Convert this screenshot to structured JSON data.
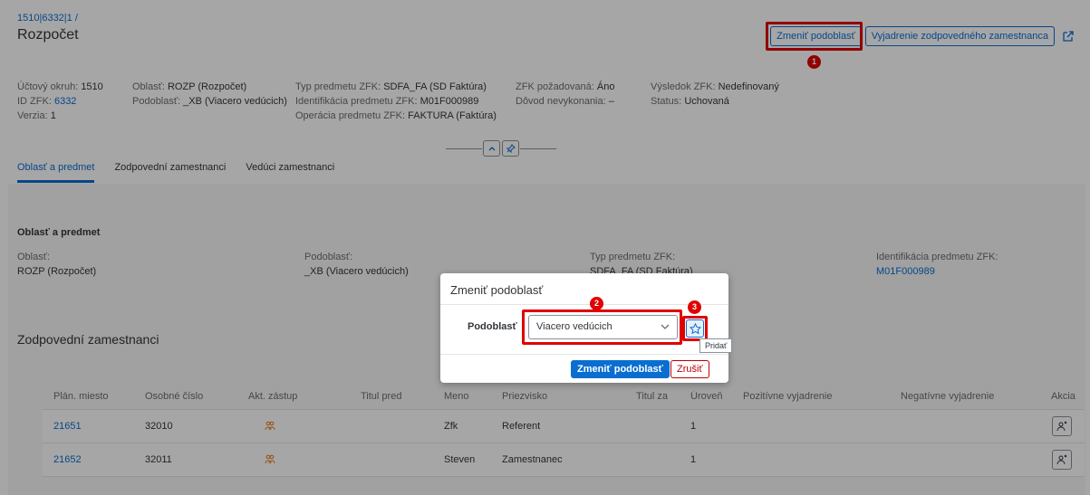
{
  "header": {
    "breadcrumb": "1510|6332|1 /",
    "title": "Rozpočet",
    "change_subarea_label": "Zmeniť podoblasť",
    "statement_label": "Vyjadrenie zodpovedného zamestnanca",
    "badge_1": "1"
  },
  "attributes": {
    "col1": [
      {
        "label": "Účtový okruh:",
        "value": "1510",
        "link": false
      },
      {
        "label": "ID ZFK:",
        "value": "6332",
        "link": true
      },
      {
        "label": "Verzia:",
        "value": "1",
        "link": false
      }
    ],
    "col2": [
      {
        "label": "Oblasť:",
        "value": "ROZP (Rozpočet)"
      },
      {
        "label": "Podoblasť:",
        "value": "_XB (Viacero vedúcich)"
      }
    ],
    "col3": [
      {
        "label": "Typ predmetu ZFK:",
        "value": "SDFA_FA (SD Faktúra)"
      },
      {
        "label": "Identifikácia predmetu ZFK:",
        "value": "M01F000989"
      },
      {
        "label": "Operácia predmetu ZFK:",
        "value": "FAKTURA (Faktúra)"
      }
    ],
    "col4": [
      {
        "label": "ZFK požadovaná:",
        "value": "Áno"
      },
      {
        "label": "Dôvod nevykonania:",
        "value": "–"
      }
    ],
    "col5": [
      {
        "label": "Výsledok ZFK:",
        "value": "Nedefinovaný"
      },
      {
        "label": "Status:",
        "value": "Uchovaná"
      }
    ]
  },
  "tabs": [
    "Oblasť a predmet",
    "Zodpovední zamestnanci",
    "Vedúci zamestnanci"
  ],
  "section": {
    "title": "Oblasť a predmet",
    "fields": [
      {
        "label": "Oblasť:",
        "value": "ROZP (Rozpočet)",
        "link": false
      },
      {
        "label": "Podoblasť:",
        "value": "_XB (Viacero vedúcich)",
        "link": false
      },
      {
        "label": "Typ predmetu ZFK:",
        "value": "SDFA_FA (SD Faktúra)",
        "link": false
      },
      {
        "label": "Identifikácia predmetu ZFK:",
        "value": "M01F000989",
        "link": true
      }
    ]
  },
  "responsible": {
    "title": "Zodpovední zamestnanci",
    "columns": [
      "Plán. miesto",
      "Osobné číslo",
      "Akt. zástup",
      "Titul pred",
      "Meno",
      "Priezvisko",
      "Titul za",
      "Úroveň",
      "Pozitívne vyjadrenie",
      "Negatívne vyjadrenie",
      "Akcia"
    ],
    "rows": [
      {
        "plan": "21651",
        "osobne": "32010",
        "meno": "Zfk",
        "priezvisko": "Referent",
        "uroven": "1"
      },
      {
        "plan": "21652",
        "osobne": "32011",
        "meno": "Steven",
        "priezvisko": "Zamestnanec",
        "uroven": "1"
      }
    ]
  },
  "dialog": {
    "title": "Zmeniť podoblasť",
    "field_label": "Podoblasť",
    "selected_value": "Viacero vedúcich",
    "add_tooltip": "Pridať",
    "confirm_label": "Zmeniť podoblasť",
    "cancel_label": "Zrušiť",
    "badge_2": "2",
    "badge_3": "3"
  },
  "colors": {
    "accent": "#0a6ed1",
    "highlight": "#e00000",
    "reject": "#bb0000"
  }
}
